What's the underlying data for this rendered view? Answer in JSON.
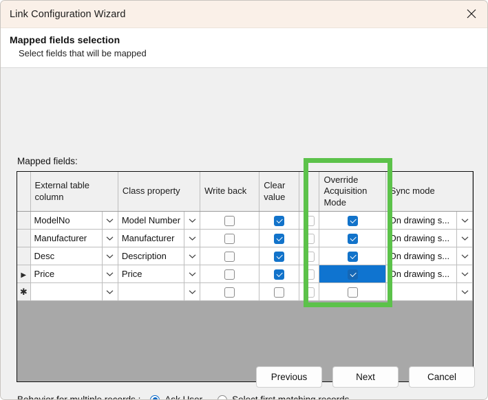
{
  "window": {
    "title": "Link Configuration Wizard",
    "close_icon": "close-icon"
  },
  "header": {
    "title": "Mapped fields selection",
    "subtitle": "Select fields that will be mapped"
  },
  "grid_label": "Mapped fields:",
  "grid": {
    "columns": [
      {
        "key": "rowhdr",
        "label": ""
      },
      {
        "key": "external",
        "label": "External table column"
      },
      {
        "key": "classprop",
        "label": "Class property"
      },
      {
        "key": "writeback",
        "label": "Write back"
      },
      {
        "key": "clearval",
        "label": "Clear value"
      },
      {
        "key": "narrow",
        "label": ""
      },
      {
        "key": "override",
        "label": "Override Acquisition Mode"
      },
      {
        "key": "syncmode",
        "label": "Sync mode"
      }
    ],
    "rows": [
      {
        "marker": "",
        "external": "ModelNo",
        "classprop": "Model Number",
        "writeback": false,
        "clearval": true,
        "narrow": false,
        "override": true,
        "override_selected": false,
        "syncmode": "On drawing s..."
      },
      {
        "marker": "",
        "external": "Manufacturer",
        "classprop": "Manufacturer",
        "writeback": false,
        "clearval": true,
        "narrow": false,
        "override": true,
        "override_selected": false,
        "syncmode": "On drawing s..."
      },
      {
        "marker": "",
        "external": "Desc",
        "classprop": "Description",
        "writeback": false,
        "clearval": true,
        "narrow": false,
        "override": true,
        "override_selected": false,
        "syncmode": "On drawing s..."
      },
      {
        "marker": "▶",
        "external": "Price",
        "classprop": "Price",
        "writeback": false,
        "clearval": true,
        "narrow": false,
        "override": true,
        "override_selected": true,
        "syncmode": "On drawing s..."
      },
      {
        "marker": "✱",
        "external": "",
        "classprop": "",
        "writeback": false,
        "clearval": false,
        "narrow": false,
        "override": false,
        "override_selected": false,
        "syncmode": ""
      }
    ]
  },
  "annotation": {
    "name": "override-acquisition-mode-highlight",
    "color": "#5cc24a"
  },
  "behaviour": {
    "label": "Behavior for multiple records :",
    "options": [
      {
        "label": "Ask User",
        "selected": true
      },
      {
        "label": "Select first matching records",
        "selected": false
      }
    ]
  },
  "footer": {
    "previous_label": "Previous",
    "next_label": "Next",
    "cancel_label": "Cancel"
  },
  "colors": {
    "titlebar": "#faf0e8",
    "accent": "#1273ca",
    "selection": "#0f74d0",
    "grid_empty": "#a8a8a8",
    "highlight": "#5cc24a"
  }
}
